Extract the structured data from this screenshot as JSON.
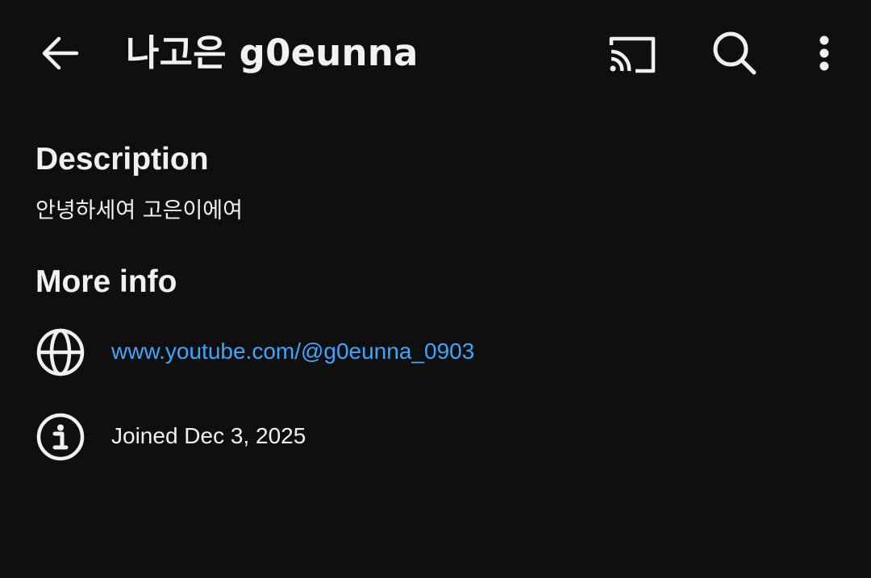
{
  "header": {
    "title": "나고은 g0eunna",
    "back_icon": "arrow-left-icon",
    "cast_icon": "cast-icon",
    "search_icon": "search-icon",
    "more_icon": "more-vert-icon"
  },
  "description": {
    "heading": "Description",
    "text": "안녕하세여 고은이에여"
  },
  "more_info": {
    "heading": "More info",
    "website": {
      "icon": "globe-icon",
      "text": "www.youtube.com/@g0eunna_0903"
    },
    "joined": {
      "icon": "info-icon",
      "text": "Joined Dec 3, 2025"
    }
  },
  "colors": {
    "background": "#0f0f0f",
    "text": "#f1f1f1",
    "link": "#3ea6ff"
  }
}
